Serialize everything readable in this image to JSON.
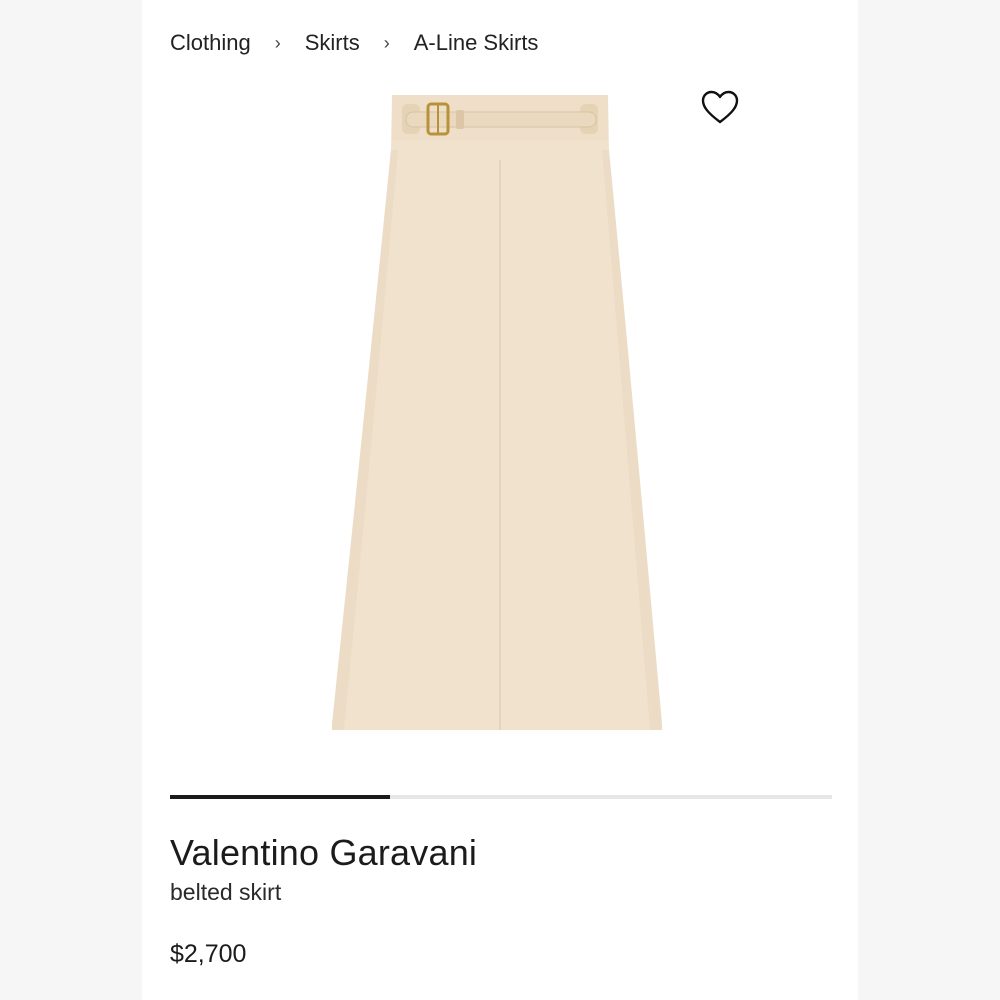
{
  "breadcrumb": {
    "items": [
      {
        "label": "Clothing"
      },
      {
        "label": "Skirts"
      },
      {
        "label": "A-Line Skirts"
      }
    ],
    "separator": "›"
  },
  "product_image": {
    "icon": "skirt-image",
    "colors": {
      "fabric": "#f1e2cd",
      "fabric_shadow": "#e8d6bd",
      "belt": "#ead9bf",
      "buckle": "#b8923a"
    }
  },
  "favorite": {
    "icon": "heart-outline-icon"
  },
  "gallery": {
    "progress": 0.333
  },
  "product": {
    "brand": "Valentino Garavani",
    "name": "belted skirt",
    "price": "$2,700"
  }
}
